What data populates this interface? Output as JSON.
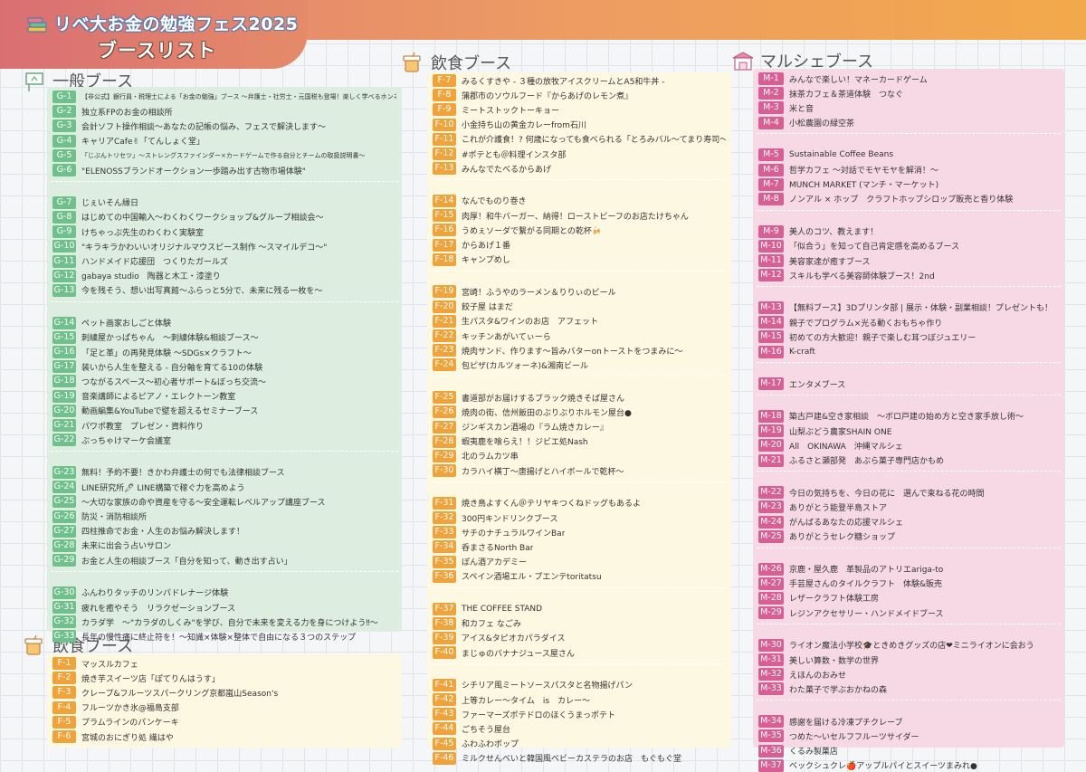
{
  "header": {
    "title_line1": "リベ大お金の勉強フェス2025",
    "title_line2": "ブースリスト"
  },
  "sections": {
    "general": "一般ブース",
    "food": "飲食ブース",
    "marche": "マルシェブース"
  },
  "general_groups": [
    [
      {
        "id": "G-1",
        "name": "【非公式】銀行員・税理士による「お金の勉強」ブース 〜弁護士・社労士・元国税も登場！楽しく学べるホンネセミナー〜",
        "small": true
      },
      {
        "id": "G-2",
        "name": "独立系FPのお金の相談所"
      },
      {
        "id": "G-3",
        "name": "会計ソフト操作相談〜あなたの記帳の悩み、フェスで解決します〜"
      },
      {
        "id": "G-4",
        "name": "キャリアCafe✌「てんしょく堂」"
      },
      {
        "id": "G-5",
        "name": "「じぶんトリセツ」〜ストレングスファインダー×カードゲームで作る自分とチームの取扱説明書〜",
        "small": true
      },
      {
        "id": "G-6",
        "name": "\"ELENOSSブランドオークション一歩踏み出す古物市場体験\""
      }
    ],
    [
      {
        "id": "G-7",
        "name": "じぇいそん縁日"
      },
      {
        "id": "G-8",
        "name": "はじめての中国輸入〜わくわくワークショップ&グループ相談会〜"
      },
      {
        "id": "G-9",
        "name": "けちゃっぷ先生のわくわく実験室"
      },
      {
        "id": "G-10",
        "name": "\"キラキラかわいいオリジナルマウスピース制作 〜スマイルデコ〜\""
      },
      {
        "id": "G-11",
        "name": "ハンドメイド応援団　つくりたガールズ"
      },
      {
        "id": "G-12",
        "name": "gabaya studio　陶器と木工・漆塗り"
      },
      {
        "id": "G-13",
        "name": "今を残そう、想い出写真館〜ふらっと5分で、未来に残る一枚を〜"
      }
    ],
    [
      {
        "id": "G-14",
        "name": "ペット画家おしごと体験"
      },
      {
        "id": "G-15",
        "name": "刺繍屋かっぱちゃん　〜刺繍体験&相談ブース〜"
      },
      {
        "id": "G-16",
        "name": "「足と革」の再発見体験 〜SDGs×クラフト〜"
      },
      {
        "id": "G-17",
        "name": "装いから人生を整える - 自分軸を育てる10の体験"
      },
      {
        "id": "G-18",
        "name": "つながるスペース〜初心者サポート&ぼっち交流〜"
      },
      {
        "id": "G-19",
        "name": "音楽講師によるピアノ・エレクトーン教室"
      },
      {
        "id": "G-20",
        "name": "動画編集&YouTubeで壁を超えるセミナーブース"
      },
      {
        "id": "G-21",
        "name": "パワポ教室　プレゼン・資料作り"
      },
      {
        "id": "G-22",
        "name": "ぶっちゃけマーケ会議室"
      }
    ],
    [
      {
        "id": "G-23",
        "name": "無料！予約不要！きかわ弁護士の何でも法律相談ブース"
      },
      {
        "id": "G-24",
        "name": "LINE研究所🖊 LINE構築で稼ぐ力を高めよう"
      },
      {
        "id": "G-25",
        "name": "〜大切な家族の命や資産を守る〜安全運転レベルアップ講座ブース"
      },
      {
        "id": "G-26",
        "name": "防災・消防相談所"
      },
      {
        "id": "G-27",
        "name": "四柱推命でお金・人生のお悩み解決します！"
      },
      {
        "id": "G-28",
        "name": "未来に出会う占いサロン"
      },
      {
        "id": "G-29",
        "name": "お金と人生の相談ブース「自分を知って、動き出す占い」"
      }
    ],
    [
      {
        "id": "G-30",
        "name": "ふんわりタッチのリンパドレナージ体験"
      },
      {
        "id": "G-31",
        "name": "疲れを癒やそう　リラクゼーションブース"
      },
      {
        "id": "G-32",
        "name": "カラダ学　〜\"カラダのしくみ\"を学び、自分で未来を変える力を身につけよう‼〜"
      },
      {
        "id": "G-33",
        "name": "長年の慢性痛に終止符を！〜知識×体験×整体で自由になる３つのステップ"
      }
    ]
  ],
  "food_left": [
    {
      "id": "F-1",
      "name": "マッスルカフェ"
    },
    {
      "id": "F-2",
      "name": "焼き芋スイーツ店「ぽてりんはうす」"
    },
    {
      "id": "F-3",
      "name": "クレープ&フルーツスパークリング京都嵐山Season's"
    },
    {
      "id": "F-4",
      "name": "フルーツかき氷@福島支部"
    },
    {
      "id": "F-5",
      "name": "プラムラインのパンケーキ"
    },
    {
      "id": "F-6",
      "name": "宮城のおにぎり処 繊はや"
    }
  ],
  "food_groups": [
    [
      {
        "id": "F-7",
        "name": "みるくすきや  - ３種の放牧アイスクリームとA5和牛丼 -"
      },
      {
        "id": "F-8",
        "name": "蒲郡市のソウルフード『からあげのレモン煮』"
      },
      {
        "id": "F-9",
        "name": "ミートストックトーキョー"
      },
      {
        "id": "F-10",
        "name": "小金持ち山の黄金カレーfrom石川"
      },
      {
        "id": "F-11",
        "name": "これが介護食！? 何歳になっても食べられる「とろみバル〜てまり寿司〜」"
      },
      {
        "id": "F-12",
        "name": "#ポテとも＠料理インスタ部"
      },
      {
        "id": "F-13",
        "name": "みんなでたべるからあげ"
      }
    ],
    [
      {
        "id": "F-14",
        "name": "なんでものり巻き"
      },
      {
        "id": "F-15",
        "name": "肉厚！和牛バーガー、納得！ローストビーフのお店たけちゃん"
      },
      {
        "id": "F-16",
        "name": "うめぇソーダで繋がる同期との乾杯🍻"
      },
      {
        "id": "F-17",
        "name": "からあげ１番"
      },
      {
        "id": "F-18",
        "name": "キャンプめし"
      }
    ],
    [
      {
        "id": "F-19",
        "name": "宮崎！ふうやのラーメン＆りりぃのビール"
      },
      {
        "id": "F-20",
        "name": "餃子屋 はまだ"
      },
      {
        "id": "F-21",
        "name": "生パスタ&ワインのお店　アフェット"
      },
      {
        "id": "F-22",
        "name": "キッチンあがいてぃーら"
      },
      {
        "id": "F-23",
        "name": "焼肉サンド、作ります〜旨みバターonトーストをつまみに〜"
      },
      {
        "id": "F-24",
        "name": "包ピザ(カルツォーネ)&湘南ビール"
      }
    ],
    [
      {
        "id": "F-25",
        "name": "書道部がお届けするブラック焼きそば屋さん"
      },
      {
        "id": "F-26",
        "name": "焼肉の街、信州飯田のぶりぶりホルモン屋台●"
      },
      {
        "id": "F-27",
        "name": "ジンギスカン酒場の『ラム焼きカレー』"
      },
      {
        "id": "F-28",
        "name": "蝦夷鹿を喰らえ！！ジビエ処Nash"
      },
      {
        "id": "F-29",
        "name": "北のラムカツ串"
      },
      {
        "id": "F-30",
        "name": "カラハイ横丁〜唐揚げとハイボールで乾杯〜"
      }
    ],
    [
      {
        "id": "F-31",
        "name": "焼き鳥よすくん＠テリヤキつくねドッグもあるよ"
      },
      {
        "id": "F-32",
        "name": "300円キンドリンクブース"
      },
      {
        "id": "F-33",
        "name": "サチのナチュラルワインBar"
      },
      {
        "id": "F-34",
        "name": "呑まさるNorth Bar"
      },
      {
        "id": "F-35",
        "name": "ぽん酒アカデミー"
      },
      {
        "id": "F-36",
        "name": "スペイン酒場エル・プエンテtoritatsu"
      }
    ],
    [
      {
        "id": "F-37",
        "name": "THE COFFEE STAND"
      },
      {
        "id": "F-38",
        "name": "和カフェ なごみ"
      },
      {
        "id": "F-39",
        "name": "アイス&タピオカパラダイス"
      },
      {
        "id": "F-40",
        "name": "まじゅのバナナジュース屋さん"
      }
    ],
    [
      {
        "id": "F-41",
        "name": "シチリア風ミートソースパスタと名物揚げパン"
      },
      {
        "id": "F-42",
        "name": "上等カレー〜タイム　is　カレー〜"
      },
      {
        "id": "F-43",
        "name": "ファーマーズポテドロのほくうまっポテト"
      },
      {
        "id": "F-44",
        "name": "ごちそう屋台"
      },
      {
        "id": "F-45",
        "name": "ふわふわポップ"
      },
      {
        "id": "F-46",
        "name": "ミルクせんべいと韓国風ベビーカステラのお店　もぐもぐ堂"
      }
    ]
  ],
  "marche_groups": [
    [
      {
        "id": "M-1",
        "name": "みんなで楽しい！マネーカードゲーム"
      },
      {
        "id": "M-2",
        "name": "抹茶カフェ＆茶道体験　つなぐ"
      },
      {
        "id": "M-3",
        "name": "米と音"
      },
      {
        "id": "M-4",
        "name": "小松農園の緑空茶"
      }
    ],
    [
      {
        "id": "M-5",
        "name": "Sustainable Coffee Beans"
      },
      {
        "id": "M-6",
        "name": "哲学カフェ 〜対話でモヤモヤを解消！〜"
      },
      {
        "id": "M-7",
        "name": "MUNCH MARKET (マンチ・マーケット)"
      },
      {
        "id": "M-8",
        "name": "ノンアル × ホップ　クラフトホップシロップ販売と香り体験"
      }
    ],
    [
      {
        "id": "M-9",
        "name": "美人のコツ、教えます！"
      },
      {
        "id": "M-10",
        "name": "「似合う」を知って自己肯定感を高めるブース"
      },
      {
        "id": "M-11",
        "name": "美容家達が癒すブース"
      },
      {
        "id": "M-12",
        "name": "スキルも学べる美容師体験ブース！2nd"
      }
    ],
    [
      {
        "id": "M-13",
        "name": "【無料ブース】3Dプリンタ部 | 展示・体験・副業相談！プレゼントも！"
      },
      {
        "id": "M-14",
        "name": "親子でプログラム×光る動くおもちゃ作り"
      },
      {
        "id": "M-15",
        "name": "初めての方大歓迎！親子で楽しむ耳つぼジュエリー"
      },
      {
        "id": "M-16",
        "name": "K-craft"
      }
    ],
    [
      {
        "id": "M-17",
        "name": "エンタメブース"
      }
    ],
    [
      {
        "id": "M-18",
        "name": "築古戸建&空き家相談　〜ボロ戸建の始め方と空き家手放し術〜"
      },
      {
        "id": "M-19",
        "name": "山梨ぶどう農家SHAIN ONE"
      },
      {
        "id": "M-20",
        "name": "All　OKINAWA　沖縄マルシェ"
      },
      {
        "id": "M-21",
        "name": "ふるさと瀬部発　あぶら菓子専門店かもめ"
      }
    ],
    [
      {
        "id": "M-22",
        "name": "今日の気持ちを、今日の花に　選んで束ねる花の時間"
      },
      {
        "id": "M-23",
        "name": "ありがとう能登半島ストア"
      },
      {
        "id": "M-24",
        "name": "がんばるあなたの応援マルシェ"
      },
      {
        "id": "M-25",
        "name": "ありがとうセレク糖ショップ"
      }
    ],
    [
      {
        "id": "M-26",
        "name": "京鹿・屋久鹿　革製品のアトリエariga-to"
      },
      {
        "id": "M-27",
        "name": "手芸屋さんのタイルクラフト　体験&販売"
      },
      {
        "id": "M-28",
        "name": "レザークラフト体験工房"
      },
      {
        "id": "M-29",
        "name": "レジンアクセサリー・ハンドメイドブース"
      }
    ],
    [
      {
        "id": "M-30",
        "name": "ライオン魔法小学校🎓ときめきグッズの店❤ミニライオンに会おう"
      },
      {
        "id": "M-31",
        "name": "美しい算数・数学の世界"
      },
      {
        "id": "M-32",
        "name": "えほんのおみせ"
      },
      {
        "id": "M-33",
        "name": "わた菓子で学ぶおかねの森"
      }
    ],
    [
      {
        "id": "M-34",
        "name": "感謝を届ける冷凍プチクレープ"
      },
      {
        "id": "M-35",
        "name": "つめた〜いセルフフルーツサイダー"
      },
      {
        "id": "M-36",
        "name": "くるみ製菓店"
      },
      {
        "id": "M-37",
        "name": "ベックシュクレ🍎アップルパイとスイーツまみれ●"
      }
    ]
  ],
  "colors": {
    "general_badge": "#6fc08a",
    "food_badge": "#f0a33a",
    "marche_badge": "#d85f94",
    "general_panel": "#ddeee0",
    "food_panel": "#fdf8e2",
    "marche_panel": "#f6d9e4"
  },
  "icons": {
    "general": "signboard-icon",
    "food": "drink-cup-icon",
    "marche": "market-stall-icon",
    "logo": "books-logo-icon"
  }
}
